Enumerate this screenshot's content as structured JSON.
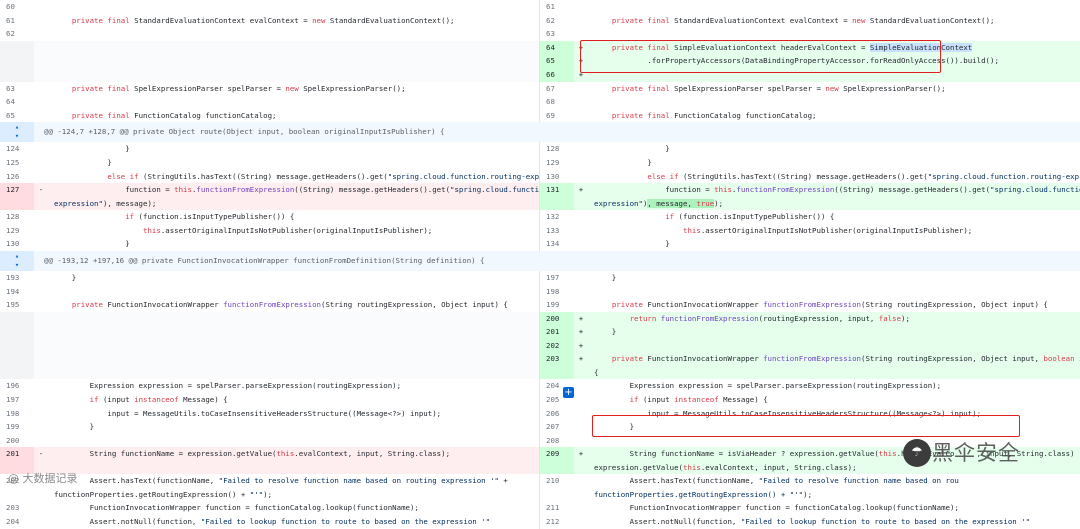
{
  "hunks": [
    "@@ -124,7 +128,7 @@ private Object route(Object input, boolean originalInputIsPublisher) {",
    "@@ -193,12 +197,16 @@ private FunctionInvocationWrapper functionFromDefinition(String definition) {"
  ],
  "rows": [
    {
      "l": {
        "n": "60",
        "c": ""
      },
      "r": {
        "n": "61",
        "c": ""
      }
    },
    {
      "l": {
        "n": "61",
        "c": "    private final StandardEvaluationContext evalContext = new StandardEvaluationContext();"
      },
      "r": {
        "n": "62",
        "c": "    private final StandardEvaluationContext evalContext = new StandardEvaluationContext();"
      }
    },
    {
      "l": {
        "n": "62",
        "c": ""
      },
      "r": {
        "n": "63",
        "c": ""
      }
    },
    {
      "l": {
        "n": "",
        "c": ""
      },
      "r": {
        "n": "64",
        "m": "+",
        "c": "    private final SimpleEvaluationContext headerEvalContext = SimpleEvaluationContext"
      }
    },
    {
      "l": {
        "n": "",
        "c": ""
      },
      "r": {
        "n": "65",
        "m": "+",
        "c": "            .forPropertyAccessors(DataBindingPropertyAccessor.forReadOnlyAccess()).build();"
      }
    },
    {
      "l": {
        "n": "",
        "c": ""
      },
      "r": {
        "n": "66",
        "m": "+",
        "c": ""
      }
    },
    {
      "l": {
        "n": "63",
        "c": "    private final SpelExpressionParser spelParser = new SpelExpressionParser();"
      },
      "r": {
        "n": "67",
        "c": "    private final SpelExpressionParser spelParser = new SpelExpressionParser();"
      }
    },
    {
      "l": {
        "n": "64",
        "c": ""
      },
      "r": {
        "n": "68",
        "c": ""
      }
    },
    {
      "l": {
        "n": "65",
        "c": "    private final FunctionCatalog functionCatalog;"
      },
      "r": {
        "n": "69",
        "c": "    private final FunctionCatalog functionCatalog;"
      }
    }
  ],
  "rows2": [
    {
      "l": {
        "n": "124",
        "c": "                }"
      },
      "r": {
        "n": "128",
        "c": "                }"
      }
    },
    {
      "l": {
        "n": "125",
        "c": "            }"
      },
      "r": {
        "n": "129",
        "c": "            }"
      }
    },
    {
      "l": {
        "n": "126",
        "c": "            else if (StringUtils.hasText((String) message.getHeaders().get(\"spring.cloud.function.routing-expression\"))) {"
      },
      "r": {
        "n": "130",
        "c": "            else if (StringUtils.hasText((String) message.getHeaders().get(\"spring.cloud.function.routing-expression\"))) {"
      }
    },
    {
      "l": {
        "n": "127",
        "m": "-",
        "c": "                function = this.functionFromExpression((String) message.getHeaders().get(\"spring.cloud.function.routing-\nexpression\"), message);"
      },
      "r": {
        "n": "131",
        "m": "+",
        "c": "                function = this.functionFromExpression((String) message.getHeaders().get(\"spring.cloud.function.routing-\nexpression\"), message, true);"
      }
    },
    {
      "l": {
        "n": "128",
        "c": "                if (function.isInputTypePublisher()) {"
      },
      "r": {
        "n": "132",
        "c": "                if (function.isInputTypePublisher()) {"
      }
    },
    {
      "l": {
        "n": "129",
        "c": "                    this.assertOriginalInputIsNotPublisher(originalInputIsPublisher);"
      },
      "r": {
        "n": "133",
        "c": "                    this.assertOriginalInputIsNotPublisher(originalInputIsPublisher);"
      }
    },
    {
      "l": {
        "n": "130",
        "c": "                }"
      },
      "r": {
        "n": "134",
        "c": "                }"
      }
    }
  ],
  "rows3": [
    {
      "l": {
        "n": "193",
        "c": "    }"
      },
      "r": {
        "n": "197",
        "c": "    }"
      }
    },
    {
      "l": {
        "n": "194",
        "c": ""
      },
      "r": {
        "n": "198",
        "c": ""
      }
    },
    {
      "l": {
        "n": "195",
        "c": "    private FunctionInvocationWrapper functionFromExpression(String routingExpression, Object input) {"
      },
      "r": {
        "n": "199",
        "c": "    private FunctionInvocationWrapper functionFromExpression(String routingExpression, Object input) {"
      }
    },
    {
      "l": {
        "n": "",
        "c": ""
      },
      "r": {
        "n": "200",
        "m": "+",
        "c": "        return functionFromExpression(routingExpression, input, false);"
      }
    },
    {
      "l": {
        "n": "",
        "c": ""
      },
      "r": {
        "n": "201",
        "m": "+",
        "c": "    }"
      }
    },
    {
      "l": {
        "n": "",
        "c": ""
      },
      "r": {
        "n": "202",
        "m": "+",
        "c": ""
      }
    },
    {
      "l": {
        "n": "",
        "c": ""
      },
      "r": {
        "n": "203",
        "m": "+",
        "c": "    private FunctionInvocationWrapper functionFromExpression(String routingExpression, Object input, boolean isViaHeader)\n{"
      }
    },
    {
      "l": {
        "n": "196",
        "c": "        Expression expression = spelParser.parseExpression(routingExpression);"
      },
      "r": {
        "n": "204",
        "c": "        Expression expression = spelParser.parseExpression(routingExpression);"
      }
    },
    {
      "l": {
        "n": "197",
        "c": "        if (input instanceof Message) {"
      },
      "r": {
        "n": "205",
        "c": "        if (input instanceof Message) {"
      }
    },
    {
      "l": {
        "n": "198",
        "c": "            input = MessageUtils.toCaseInsensitiveHeadersStructure((Message<?>) input);"
      },
      "r": {
        "n": "206",
        "c": "            input = MessageUtils.toCaseInsensitiveHeadersStructure((Message<?>) input);"
      }
    },
    {
      "l": {
        "n": "199",
        "c": "        }"
      },
      "r": {
        "n": "207",
        "c": "        }"
      }
    },
    {
      "l": {
        "n": "200",
        "c": ""
      },
      "r": {
        "n": "208",
        "c": ""
      }
    },
    {
      "l": {
        "n": "201",
        "m": "-",
        "c": "        String functionName = expression.getValue(this.evalContext, input, String.class);"
      },
      "r": {
        "n": "209",
        "m": "+",
        "c": "        String functionName = isViaHeader ? expression.getValue(this.headerEvalCo     , input, String.class) :\nexpression.getValue(this.evalContext, input, String.class);"
      }
    },
    {
      "l": {
        "n": "202",
        "c": "        Assert.hasText(functionName, \"Failed to resolve function name based on routing expression '\" +\nfunctionProperties.getRoutingExpression() + \"'\");"
      },
      "r": {
        "n": "210",
        "c": "        Assert.hasText(functionName, \"Failed to resolve function name based on rou\nfunctionProperties.getRoutingExpression() + \"'\");"
      }
    },
    {
      "l": {
        "n": "203",
        "c": "        FunctionInvocationWrapper function = functionCatalog.lookup(functionName);"
      },
      "r": {
        "n": "211",
        "c": "        FunctionInvocationWrapper function = functionCatalog.lookup(functionName);"
      }
    },
    {
      "l": {
        "n": "204",
        "c": "        Assert.notNull(function, \"Failed to lookup function to route to based on the expression '\""
      },
      "r": {
        "n": "212",
        "c": "        Assert.notNull(function, \"Failed to lookup function to route to based on the expression '\""
      }
    }
  ],
  "watermark": {
    "right": "黑伞安全",
    "left": "@ 大数据记录"
  },
  "colors": {
    "add": "#e6ffed",
    "del": "#ffeef0",
    "hunk": "#f1f8ff",
    "highlight": "#e02020"
  }
}
